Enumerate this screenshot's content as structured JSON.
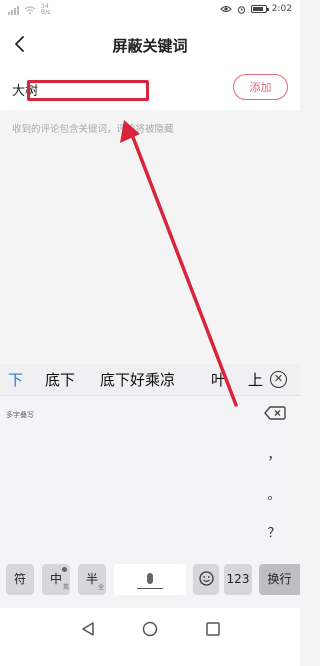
{
  "status_bar": {
    "network": "34\nB/s",
    "time": "2:02",
    "icons": [
      "signal-icon",
      "wifi-icon",
      "eye-icon",
      "alarm-icon",
      "battery-icon"
    ]
  },
  "header": {
    "title": "屏蔽关键词",
    "back_icon": "chevron-left-icon"
  },
  "keyword_input": {
    "value": "大树"
  },
  "add_button": {
    "label": "添加"
  },
  "hint": "收到的评论包含关键词，评论将被隐藏",
  "keyboard": {
    "candidate_pinyin": "下",
    "candidates": [
      "底下",
      "底下好乘凉",
      "叶",
      "上"
    ],
    "mode_label": "多字叠写",
    "punctuation": [
      "，",
      "。",
      "？",
      "！"
    ],
    "keys": {
      "symbol": "符",
      "chinese": "中",
      "chinese_sub": "英",
      "half": "半",
      "half_sub": "全",
      "number": "123",
      "enter": "换行"
    }
  },
  "colors": {
    "accent": "#e16a7e",
    "annotation": "#d8253d",
    "candidate_highlight": "#2b79d8"
  }
}
